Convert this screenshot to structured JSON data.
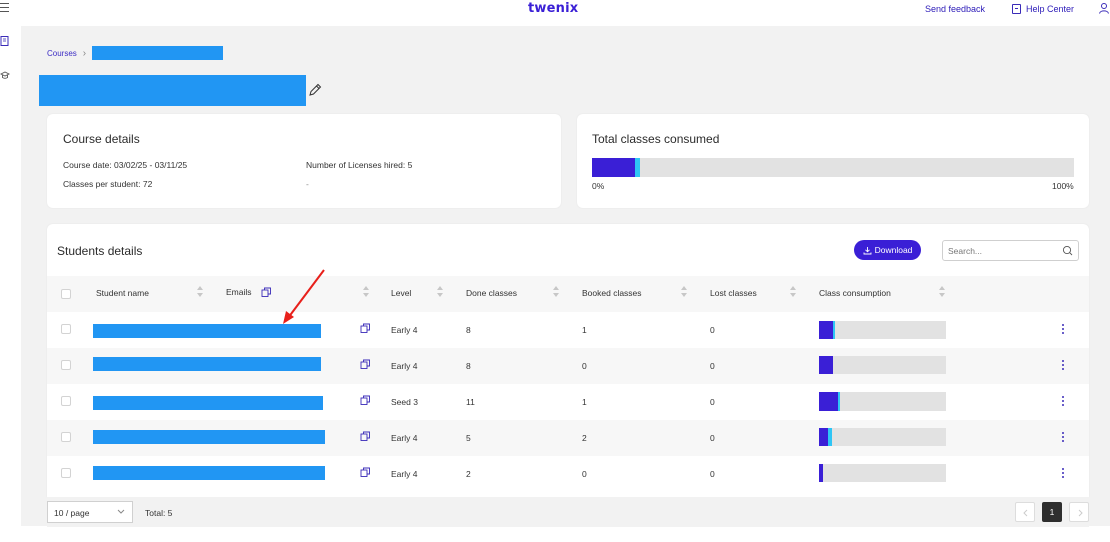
{
  "header": {
    "logo": "twenix",
    "send_feedback": "Send feedback",
    "help_center": "Help Center"
  },
  "breadcrumb": {
    "root": "Courses",
    "current_redacted": ""
  },
  "course_details": {
    "title": "Course details",
    "course_date_label": "Course date:",
    "course_date_value": "03/02/25 - 03/11/25",
    "classes_per_student_label": "Classes per student:",
    "classes_per_student_value": "72",
    "licenses_label": "Number of Licenses hired:",
    "licenses_value": "5",
    "dash": "-"
  },
  "total_classes": {
    "title": "Total classes consumed",
    "min_label": "0%",
    "max_label": "100%",
    "consumed_fraction": 0.09,
    "booked_fraction": 0.01
  },
  "students": {
    "title": "Students details",
    "download_label": "Download",
    "search_placeholder": "Search...",
    "columns": [
      "Student name",
      "Emails",
      "Level",
      "Done classes",
      "Booked classes",
      "Lost classes",
      "Class consumption"
    ],
    "rows": [
      {
        "level": "Early 4",
        "done": "8",
        "booked": "1",
        "lost": "0",
        "consumed_fraction": 0.11,
        "booked_fraction": 0.015
      },
      {
        "level": "Early 4",
        "done": "8",
        "booked": "0",
        "lost": "0",
        "consumed_fraction": 0.11,
        "booked_fraction": 0.0
      },
      {
        "level": "Seed 3",
        "done": "11",
        "booked": "1",
        "lost": "0",
        "consumed_fraction": 0.15,
        "booked_fraction": 0.015
      },
      {
        "level": "Early 4",
        "done": "5",
        "booked": "2",
        "lost": "0",
        "consumed_fraction": 0.07,
        "booked_fraction": 0.03
      },
      {
        "level": "Early 4",
        "done": "2",
        "booked": "0",
        "lost": "0",
        "consumed_fraction": 0.03,
        "booked_fraction": 0.0
      }
    ]
  },
  "pagination": {
    "per_page": "10 / page",
    "total": "Total: 5",
    "current_page": "1"
  },
  "colors": {
    "brand": "#3a1fd6",
    "booked": "#2ec5f5",
    "redaction": "#2196f3",
    "annotation_arrow": "#e8201b"
  }
}
